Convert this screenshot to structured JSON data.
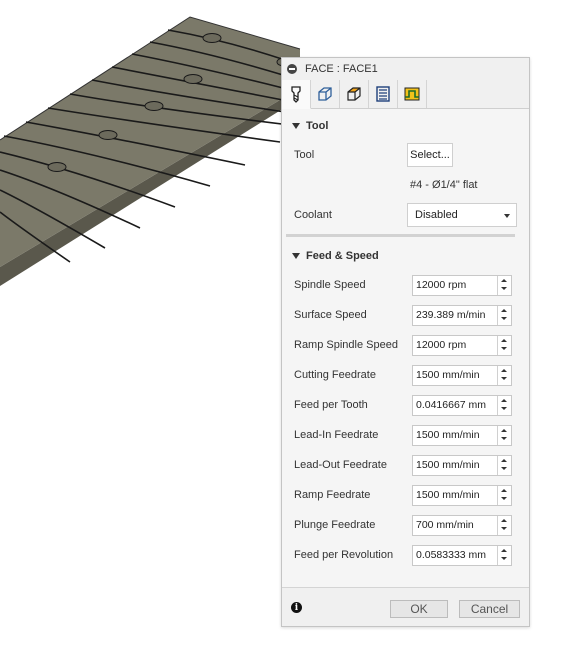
{
  "dialog": {
    "title": "FACE : FACE1",
    "tabs": [
      {
        "name": "tool-tab-icon"
      },
      {
        "name": "geometry-tab-icon"
      },
      {
        "name": "heights-tab-icon"
      },
      {
        "name": "passes-tab-icon"
      },
      {
        "name": "linking-tab-icon"
      }
    ],
    "tool_section": {
      "header": "Tool",
      "tool_label": "Tool",
      "select_button": "Select...",
      "tool_name": "#4 - Ø1/4\" flat",
      "coolant_label": "Coolant",
      "coolant_value": "Disabled"
    },
    "feed_section": {
      "header": "Feed & Speed",
      "rows": [
        {
          "label": "Spindle Speed",
          "value": "12000 rpm"
        },
        {
          "label": "Surface Speed",
          "value": "239.389 m/min"
        },
        {
          "label": "Ramp Spindle Speed",
          "value": "12000 rpm"
        },
        {
          "label": "Cutting Feedrate",
          "value": "1500 mm/min"
        },
        {
          "label": "Feed per Tooth",
          "value": "0.0416667 mm"
        },
        {
          "label": "Lead-In Feedrate",
          "value": "1500 mm/min"
        },
        {
          "label": "Lead-Out Feedrate",
          "value": "1500 mm/min"
        },
        {
          "label": "Ramp Feedrate",
          "value": "1500 mm/min"
        },
        {
          "label": "Plunge Feedrate",
          "value": "700 mm/min"
        },
        {
          "label": "Feed per Revolution",
          "value": "0.0583333 mm"
        }
      ]
    },
    "footer": {
      "info_icon": "info-icon",
      "ok_label": "OK",
      "cancel_label": "Cancel"
    }
  },
  "viewport": {
    "model": "slatted-panel-3d-model",
    "colors": {
      "top": "#7a786a",
      "side": "#5e5c50",
      "line": "#1a1a1a"
    }
  }
}
